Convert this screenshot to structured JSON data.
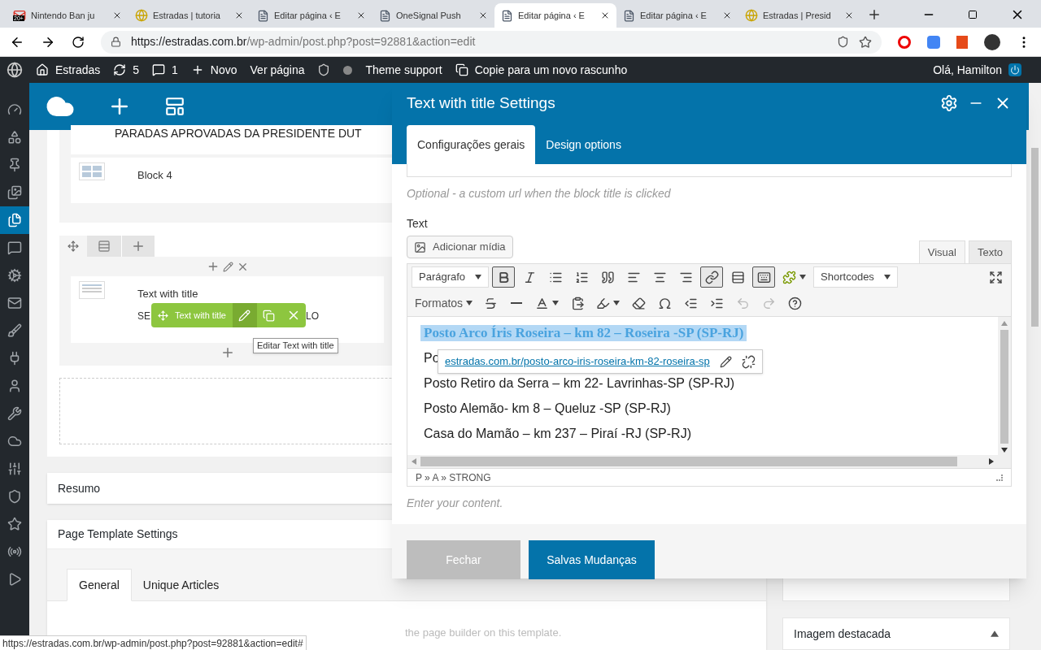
{
  "browser": {
    "tabs": [
      {
        "title": "Nintendo Ban ju",
        "kind": "mail",
        "selected": false
      },
      {
        "title": "Estradas | tutoria",
        "kind": "site",
        "selected": false
      },
      {
        "title": "Editar página ‹ E",
        "kind": "page",
        "selected": false
      },
      {
        "title": "OneSignal Push",
        "kind": "page",
        "selected": false
      },
      {
        "title": "Editar página ‹ E",
        "kind": "page",
        "selected": true
      },
      {
        "title": "Editar página ‹ E",
        "kind": "page",
        "selected": false
      },
      {
        "title": "Estradas | Presid",
        "kind": "site",
        "selected": false
      }
    ],
    "mail_badge": "20+",
    "url_host": "https://estradas.com.br",
    "url_path": "/wp-admin/post.php?post=92881&action=edit"
  },
  "admin_bar": {
    "site": "Estradas",
    "updates": "5",
    "comments": "1",
    "new": "Novo",
    "view": "Ver página",
    "theme_support": "Theme support",
    "copy": "Copie para um novo rascunho",
    "greeting": "Olá, Hamilton"
  },
  "sidebar": {
    "items": [
      {
        "kind": "dashboard",
        "selected": false
      },
      {
        "kind": "builder",
        "selected": false
      },
      {
        "kind": "pin",
        "selected": false
      },
      {
        "kind": "media",
        "selected": false
      },
      {
        "kind": "pages",
        "selected": true
      },
      {
        "kind": "comments",
        "selected": false
      },
      {
        "kind": "gears",
        "selected": false
      },
      {
        "kind": "mail",
        "selected": false
      },
      {
        "kind": "brush",
        "selected": false
      },
      {
        "kind": "plugin",
        "selected": false
      },
      {
        "kind": "user",
        "selected": false
      },
      {
        "kind": "tools",
        "selected": false
      },
      {
        "kind": "cloud",
        "selected": false
      },
      {
        "kind": "sliders",
        "selected": false
      },
      {
        "kind": "seo",
        "selected": false
      },
      {
        "kind": "badge",
        "selected": false
      },
      {
        "kind": "signal",
        "selected": false
      },
      {
        "kind": "play",
        "selected": false
      }
    ]
  },
  "builder": {
    "heading": "PARADAS APROVADAS DA PRESIDENTE DUT",
    "block": "Block 4",
    "element": {
      "title": "Text with title",
      "excerpt_start": "SE",
      "excerpt_end": "LO"
    },
    "element_toolbar": {
      "label": "Text with title"
    },
    "tooltip": "Editar Text with title"
  },
  "boxes": {
    "summary": "Resumo",
    "template": "Page Template Settings",
    "template_tabs": [
      {
        "label": "General",
        "selected": true
      },
      {
        "label": "Unique Articles",
        "selected": false
      }
    ],
    "template_note": "the page builder on this template.",
    "featured": "Imagem destacada"
  },
  "status_url": "https://estradas.com.br/wp-admin/post.php?post=92881&action=edit#",
  "modal": {
    "title": "Text with title Settings",
    "tabs": [
      {
        "label": "Configurações gerais",
        "selected": true
      },
      {
        "label": "Design options",
        "selected": false
      }
    ],
    "url_help": "Optional - a custom url when the block title is clicked",
    "text_label": "Text",
    "add_media": "Adicionar mídia",
    "editor_tabs": [
      {
        "label": "Visual",
        "selected": true
      },
      {
        "label": "Texto",
        "selected": false
      }
    ],
    "toolbar_rows": [
      [
        {
          "kind": "select",
          "label": "Parágrafo"
        },
        {
          "kind": "bold",
          "active": true
        },
        {
          "kind": "italic",
          "active": false
        },
        {
          "kind": "bullets",
          "active": false
        },
        {
          "kind": "numbers",
          "active": false
        },
        {
          "kind": "quote",
          "active": false
        },
        {
          "kind": "align-left",
          "active": false
        },
        {
          "kind": "align-center",
          "active": false
        },
        {
          "kind": "align-right",
          "active": false
        },
        {
          "kind": "link",
          "active": true
        },
        {
          "kind": "more",
          "active": false
        },
        {
          "kind": "keyboard",
          "active": true
        },
        {
          "kind": "plugin",
          "active": false
        },
        {
          "kind": "select",
          "label": "Shortcodes"
        },
        {
          "kind": "fullscreen",
          "active": false
        }
      ],
      [
        {
          "kind": "menu",
          "label": "Formatos"
        },
        {
          "kind": "strike",
          "active": false
        },
        {
          "kind": "rule",
          "active": false
        },
        {
          "kind": "text-color",
          "active": false
        },
        {
          "kind": "paste",
          "active": false
        },
        {
          "kind": "bg-color",
          "active": false
        },
        {
          "kind": "eraser",
          "active": false
        },
        {
          "kind": "omega",
          "active": false
        },
        {
          "kind": "outdent",
          "active": false
        },
        {
          "kind": "indent",
          "active": false
        },
        {
          "kind": "undo",
          "active": false
        },
        {
          "kind": "redo",
          "active": false
        },
        {
          "kind": "help",
          "active": false
        }
      ]
    ],
    "lines": [
      {
        "text": "Posto Arco Íris Roseira – km 82 – Roseira -SP (SP-RJ)",
        "kind": "link",
        "selected": true
      },
      {
        "text": "Po",
        "kind": "text",
        "selected": false
      },
      {
        "text": "Posto Retiro da Serra – km 22- Lavrinhas-SP (SP-RJ)",
        "kind": "text",
        "selected": false
      },
      {
        "text": "Posto Alemão- km 8 – Queluz -SP (SP-RJ)",
        "kind": "text",
        "selected": false
      },
      {
        "text": "Casa do Mamão – km 237 – Piraí -RJ (SP-RJ)",
        "kind": "text",
        "selected": false
      }
    ],
    "link_popup": "estradas.com.br/posto-arco-iris-roseira-km-82-roseira-sp",
    "path": "P » A » STRONG",
    "content_help": "Enter your content.",
    "buttons": [
      {
        "label": "Fechar",
        "kind": "secondary"
      },
      {
        "label": "Salvas Mudanças",
        "kind": "primary"
      }
    ]
  }
}
